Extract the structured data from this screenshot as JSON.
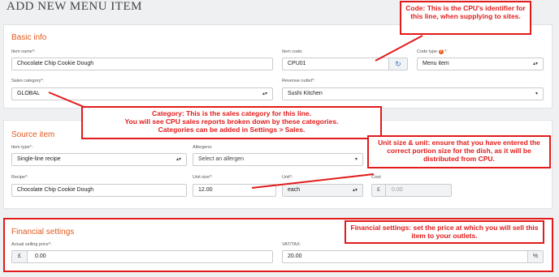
{
  "page": {
    "title": "ADD NEW MENU ITEM"
  },
  "basic_info": {
    "title": "Basic info",
    "item_name_label": "Item name*:",
    "item_name_value": "Chocolate Chip Cookie Dough",
    "item_code_label": "Item code:",
    "item_code_value": "CPU01",
    "code_type_label": "Code type",
    "code_type_suffix": "*:",
    "code_type_value": "Menu item",
    "sales_category_label": "Sales category*:",
    "sales_category_value": "GLOBAL",
    "revenue_outlet_label": "Revenue outlet*:",
    "revenue_outlet_value": "Sushi Kitchen"
  },
  "source_item": {
    "title": "Source item",
    "item_type_label": "Item type*:",
    "item_type_value": "Single-line recipe",
    "allergens_label": "Allergens:",
    "allergens_placeholder": "Select an allergen",
    "recipe_label": "Recipe*:",
    "recipe_value": "Chocolate Chip Cookie Dough",
    "unit_size_label": "Unit size*:",
    "unit_size_value": "12.00",
    "unit_label": "Unit*:",
    "unit_value": "each",
    "cost_label": "Cost:",
    "cost_currency": "£",
    "cost_value": "0.00"
  },
  "financial": {
    "title": "Financial settings",
    "price_label": "Actual selling price*:",
    "price_currency": "£",
    "price_value": "0.00",
    "vat_label": "VAT/TAX:",
    "vat_value": "20.00",
    "vat_unit": "%"
  },
  "callouts": {
    "code": "Code: This is the CPU's identifier for this line, when supplying to sites.",
    "category_line1": "Category: This is the sales category for this line.",
    "category_line2": "You will see CPU sales reports broken down by these categories.",
    "category_line3": "Categories can be added in Settings > Sales.",
    "unit": "Unit size & unit: ensure that you have entered the correct portion size for the dish, as it will be distributed from CPU.",
    "financial": "Financial settings: set the price at which you will sell this item to your outlets."
  },
  "icons": {
    "refresh": "refresh-icon",
    "help": "help-icon",
    "dropdown": "chevron-down-icon"
  },
  "colors": {
    "accent": "#e25a1c",
    "annotation": "#e21b1b",
    "refresh": "#3a7ac8"
  }
}
